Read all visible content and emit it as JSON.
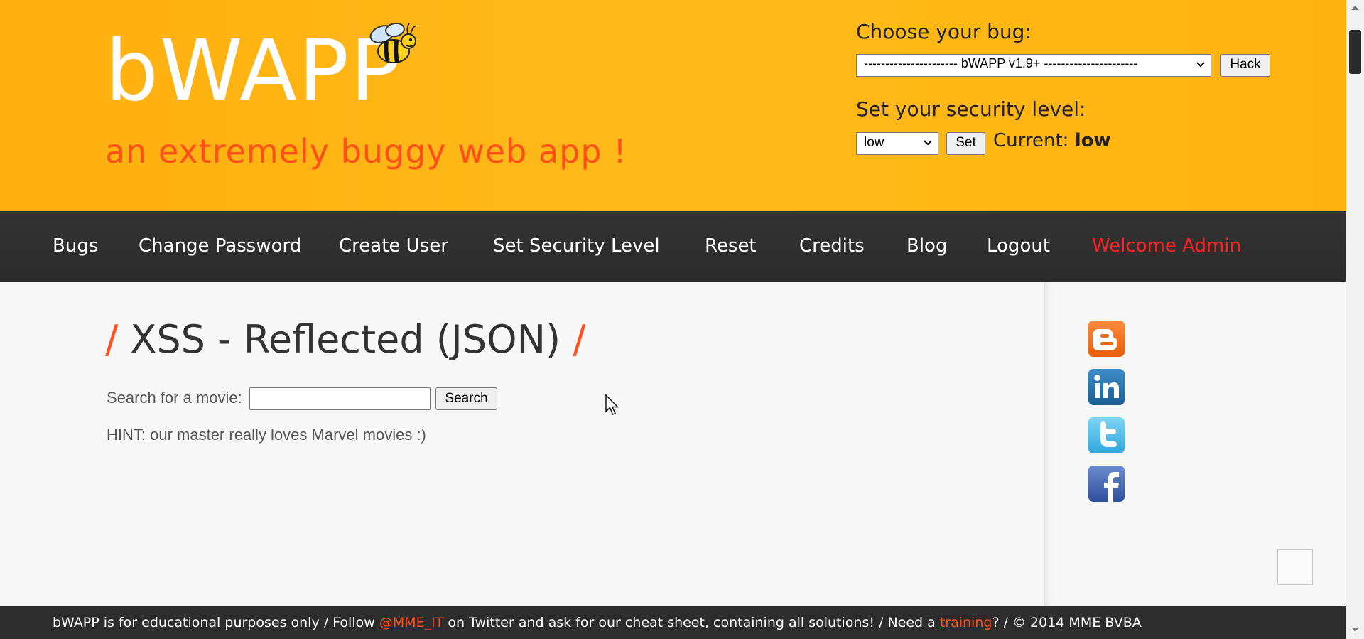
{
  "header": {
    "logo": "bWAPP",
    "tagline": "an extremely buggy web app !",
    "choose_bug_label": "Choose your bug:",
    "bug_select_value": "---------------------- bWAPP v1.9+ ----------------------",
    "hack_button": "Hack",
    "security_label": "Set your security level:",
    "level_select_value": "low",
    "set_button": "Set",
    "current_label": "Current:",
    "current_value": "low"
  },
  "nav": {
    "items": [
      "Bugs",
      "Change Password",
      "Create User",
      "Set Security Level",
      "Reset",
      "Credits",
      "Blog",
      "Logout"
    ],
    "welcome": "Welcome Admin"
  },
  "main": {
    "slash_left": "/",
    "title": "XSS - Reflected (JSON)",
    "slash_right": "/",
    "search_label": "Search for a movie:",
    "search_value": "",
    "search_button": "Search",
    "hint": "HINT: our master really loves Marvel movies :)"
  },
  "social": [
    "blogger-icon",
    "linkedin-icon",
    "twitter-icon",
    "facebook-icon"
  ],
  "footer": {
    "part1": "bWAPP is for educational purposes only / Follow ",
    "twitter_link": "@MME_IT",
    "part2": " on Twitter and ask for our cheat sheet, containing all solutions! / Need a ",
    "training_link": "training",
    "part3": "? / © 2014 MME BVBA"
  },
  "colors": {
    "header_bg": "#ffb514",
    "accent": "#ff4e1a",
    "nav_bg": "#2f2f2f",
    "welcome": "#ff2020"
  }
}
